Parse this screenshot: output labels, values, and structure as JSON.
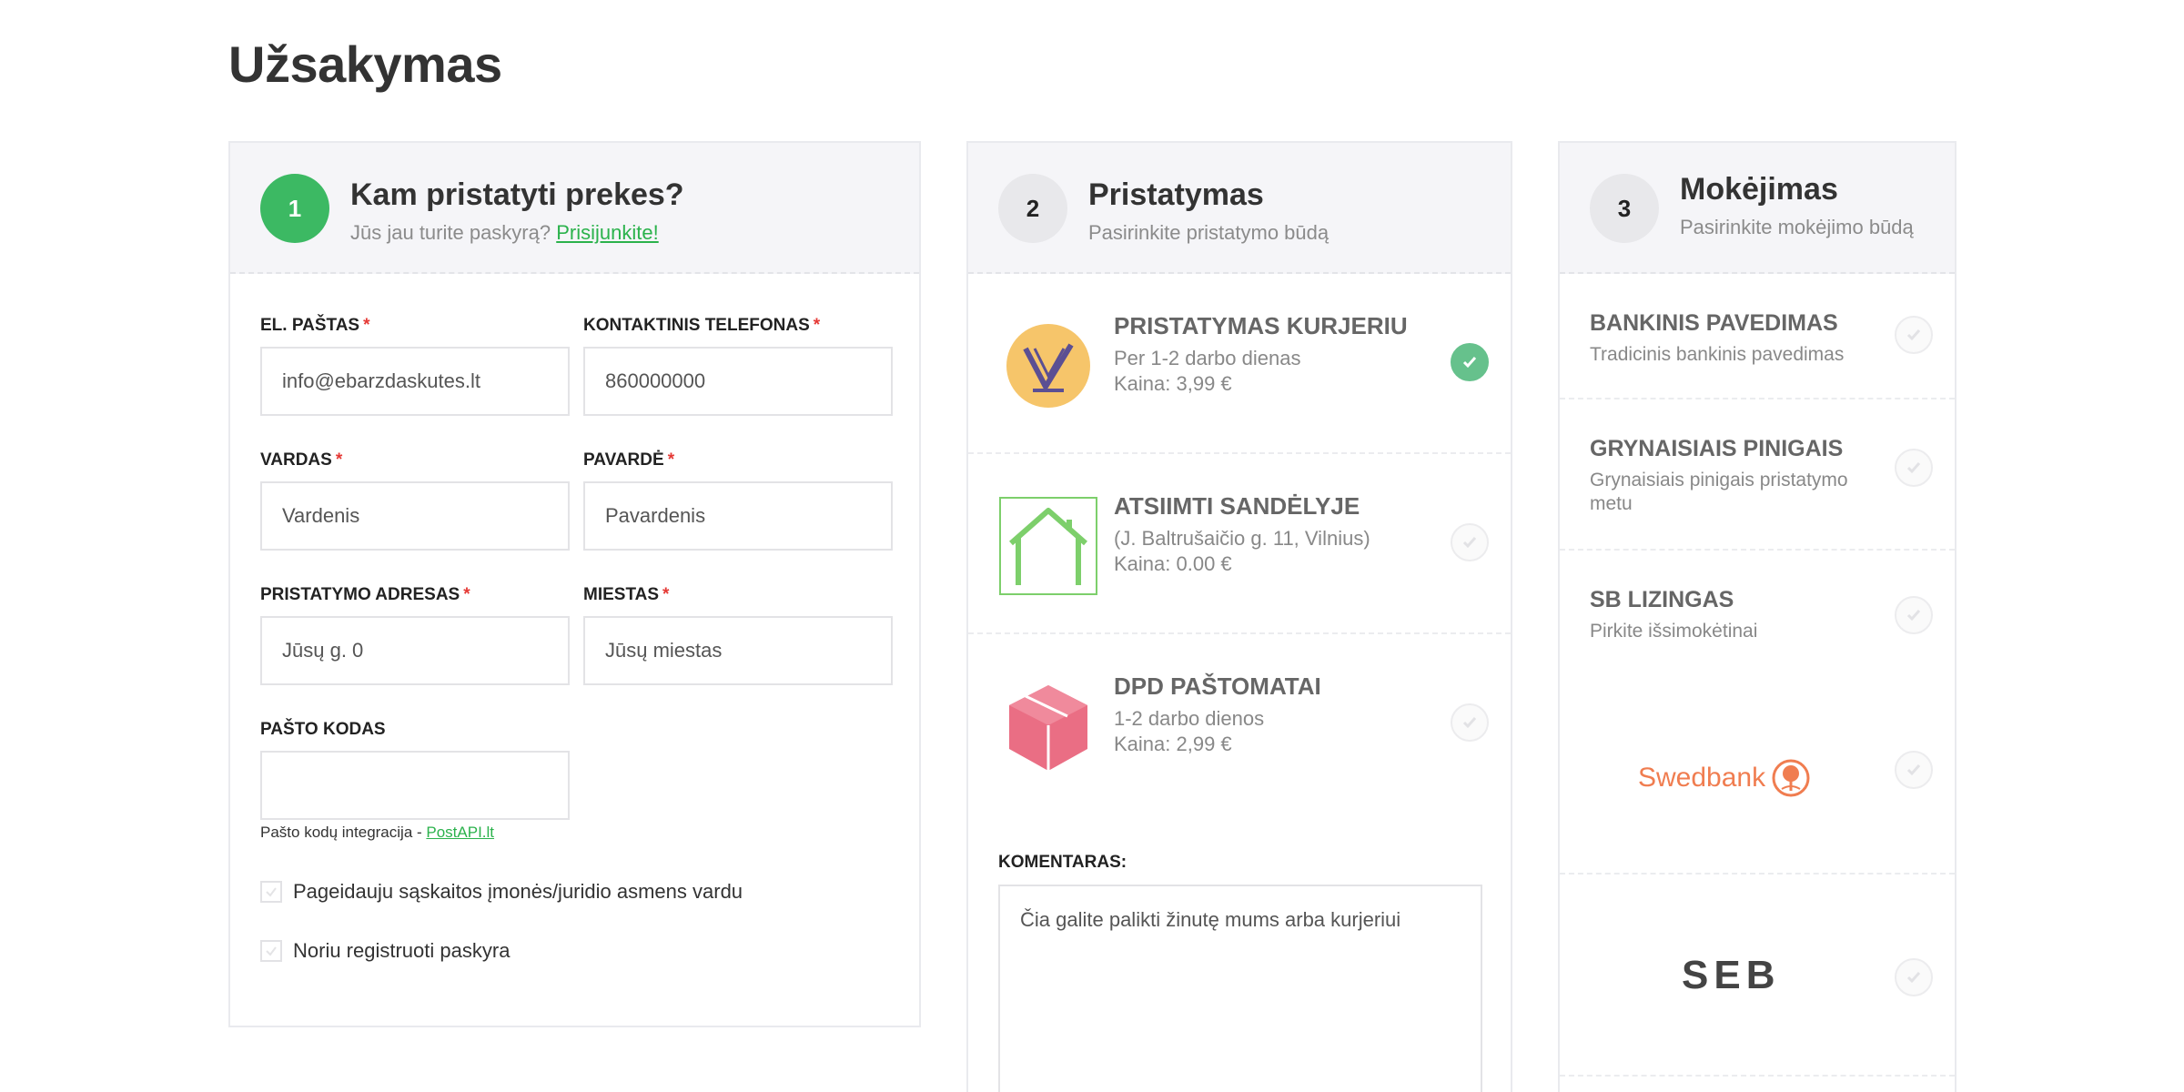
{
  "page": {
    "title": "Užsakymas"
  },
  "contact": {
    "step": "1",
    "title": "Kam pristatyti prekes?",
    "subtitle_prefix": "Jūs jau turite paskyrą?",
    "login_link": "Prisijunkite!",
    "email": {
      "label": "EL. PAŠTAS",
      "required": "*",
      "placeholder": "info@ebarzdaskutes.lt"
    },
    "phone": {
      "label": "KONTAKTINIS TELEFONAS",
      "required": "*",
      "placeholder": "860000000"
    },
    "first_name": {
      "label": "VARDAS",
      "required": "*",
      "placeholder": "Vardenis"
    },
    "last_name": {
      "label": "PAVARDĖ",
      "required": "*",
      "placeholder": "Pavardenis"
    },
    "address": {
      "label": "PRISTATYMO ADRESAS",
      "required": "*",
      "placeholder": "Jūsų g. 0"
    },
    "city": {
      "label": "MIESTAS",
      "required": "*",
      "placeholder": "Jūsų miestas"
    },
    "postcode": {
      "label": "PAŠTO KODAS",
      "placeholder": ""
    },
    "postcode_helper_prefix": "Pašto kodų integracija -",
    "postcode_helper_link": "PostAPI.lt",
    "checkbox_company": "Pageidauju sąskaitos įmonės/juridio asmens vardu",
    "checkbox_register": "Noriu registruoti paskyra"
  },
  "shipping": {
    "step": "2",
    "title": "Pristatymas",
    "subtitle": "Pasirinkite pristatymo būdą",
    "options": [
      {
        "title": "PRISTATYMAS KURJERIU",
        "line1": "Per 1-2 darbo dienas",
        "line2": "Kaina: 3,99 €",
        "logo": "venipak-express-logo",
        "selected": true
      },
      {
        "title": "ATSIIMTI SANDĖLYJE",
        "line1": "(J. Baltrušaičio g. 11, Vilnius)",
        "line2": "Kaina: 0.00 €",
        "logo": "house-icon",
        "selected": false
      },
      {
        "title": "DPD PAŠTOMATAI",
        "line1": "1-2 darbo dienos",
        "line2": "Kaina: 2,99 €",
        "logo": "dpd-box-logo",
        "selected": false
      }
    ],
    "comment_label": "KOMENTARAS:",
    "comment_placeholder": "Čia galite palikti žinutę mums arba kurjeriui",
    "accent_color": "#66c18c"
  },
  "payment": {
    "step": "3",
    "title": "Mokėjimas",
    "subtitle": "Pasirinkite mokėjimo būdą",
    "options": [
      {
        "title": "BANKINIS PAVEDIMAS",
        "subtitle": "Tradicinis bankinis pavedimas"
      },
      {
        "title": "GRYNAISIAIS PINIGAIS",
        "subtitle": "Grynaisiais pinigais pristatymo metu"
      },
      {
        "title": "SB LIZINGAS",
        "subtitle": "Pirkite išsimokėtinai"
      }
    ],
    "swedbank_label": "Swedbank",
    "seb_label": "SEB",
    "swedbank_color": "#f07d50"
  },
  "colors": {
    "primary_green": "#3cb963",
    "link_green": "#2bb24c",
    "required_red": "#e53935"
  }
}
